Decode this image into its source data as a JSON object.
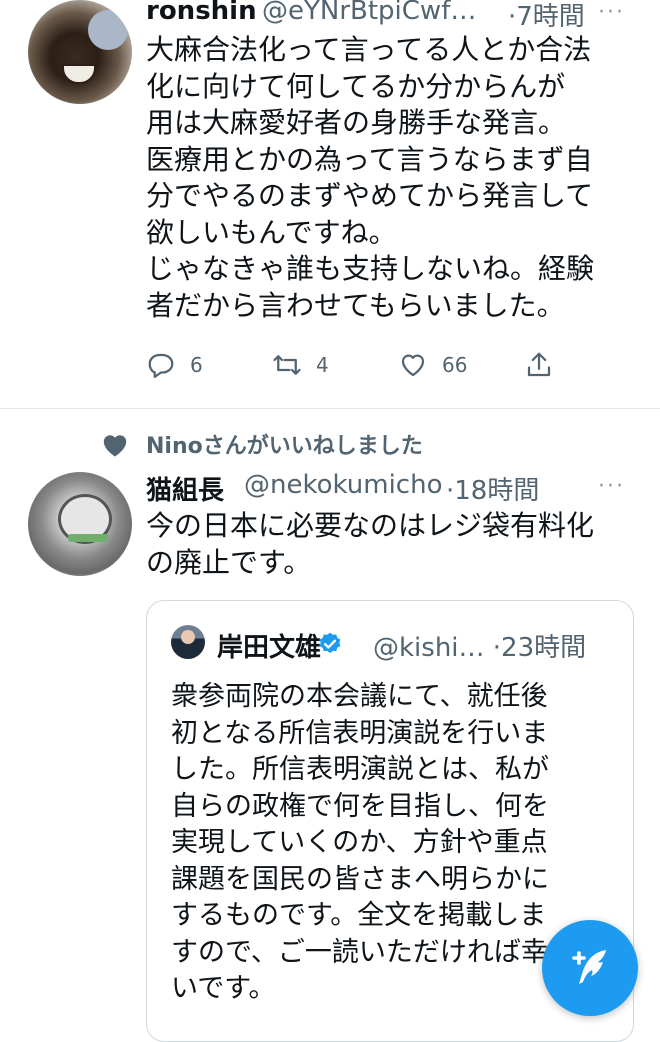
{
  "tweet1": {
    "display_name": "ronshin",
    "handle": "@eYNrBtpiCwf…",
    "time": "·7時間",
    "more": "···",
    "lines": [
      "大麻合法化って言ってる人とか合法",
      "化に向けて何してるか分からんが",
      "用は大麻愛好者の身勝手な発言。",
      "医療用とかの為って言うならまず自",
      "分でやるのまずやめてから発言して",
      "欲しいもんですね。",
      "じゃなきゃ誰も支持しないね。経験",
      "者だから言わせてもらいました。"
    ],
    "actions": {
      "replies": "6",
      "retweets": "4",
      "likes": "66"
    }
  },
  "social_context": {
    "liked_by": "Ninoさんがいいねしました"
  },
  "tweet2": {
    "display_name": "猫組長",
    "handle": "@nekokumicho",
    "time": "·18時間",
    "more": "···",
    "lines": [
      "今の日本に必要なのはレジ袋有料化",
      "の廃止です。"
    ]
  },
  "quoted_tweet": {
    "display_name": "岸田文雄",
    "handle": "@kishi…",
    "time": "·23時間",
    "lines": [
      "衆参両院の本会議にて、就任後",
      "初となる所信表明演説を行いま",
      "した。所信表明演説とは、私が",
      "自らの政権で何を目指し、何を",
      "実現していくのか、方針や重点",
      "課題を国民の皆さまへ明らかに",
      "するものです。全文を掲載しま",
      "すので、ご一読いただければ幸",
      "いです。"
    ]
  },
  "colors": {
    "accent": "#1d9bf0",
    "text_primary": "#0f1419",
    "text_secondary": "#536471",
    "divider": "#e3e7ea"
  },
  "icons": {
    "reply": "reply-icon",
    "retweet": "retweet-icon",
    "like": "heart-icon",
    "share": "share-icon",
    "verified": "verified-badge-icon",
    "compose": "compose-tweet-icon"
  }
}
